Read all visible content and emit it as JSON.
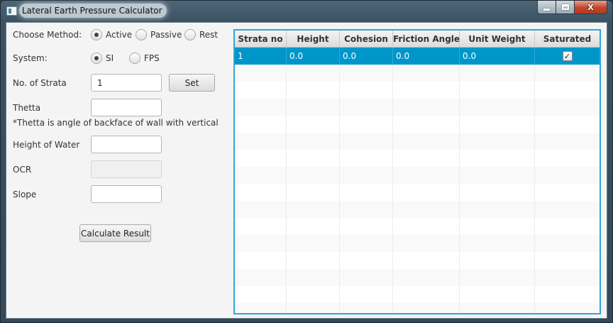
{
  "window": {
    "title": "Lateral Earth Pressure Calculator",
    "controls": {
      "minimize": "minimize",
      "maximize": "maximize",
      "close": "X"
    }
  },
  "form": {
    "method": {
      "label": "Choose Method:",
      "options": [
        {
          "label": "Active",
          "selected": true
        },
        {
          "label": "Passive",
          "selected": false
        },
        {
          "label": "Rest",
          "selected": false
        }
      ]
    },
    "system": {
      "label": "System:",
      "options": [
        {
          "label": "SI",
          "selected": true
        },
        {
          "label": "FPS",
          "selected": false
        }
      ]
    },
    "strata": {
      "label": "No. of Strata",
      "value": "1",
      "set_label": "Set"
    },
    "thetta": {
      "label": "Thetta",
      "value": "",
      "note": "*Thetta is angle of backface of wall with vertical"
    },
    "water": {
      "label": "Height of Water",
      "value": ""
    },
    "ocr": {
      "label": "OCR",
      "value": "",
      "disabled": true
    },
    "slope": {
      "label": "Slope",
      "value": ""
    },
    "calculate_label": "Calculate Result"
  },
  "table": {
    "columns": [
      "Strata no",
      "Height",
      "Cohesion",
      "Friction Angle",
      "Unit Weight",
      "Saturated"
    ],
    "rows": [
      {
        "strata_no": "1",
        "height": "0.0",
        "cohesion": "0.0",
        "friction_angle": "0.0",
        "unit_weight": "0.0",
        "saturated": true
      }
    ],
    "empty_rows": 15
  },
  "colors": {
    "selection": "#0096c9",
    "table_border": "#2ea8d2"
  }
}
